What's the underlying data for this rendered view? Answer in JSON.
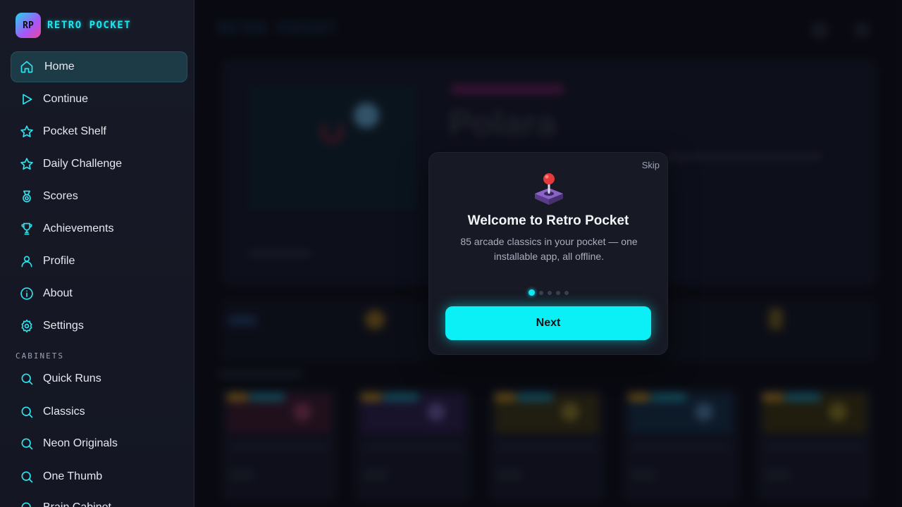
{
  "brand": {
    "logo_text": "RP",
    "name": "RETRO POCKET"
  },
  "nav": [
    {
      "label": "Home",
      "icon": "home-icon",
      "active": true
    },
    {
      "label": "Continue",
      "icon": "play-icon"
    },
    {
      "label": "Pocket Shelf",
      "icon": "star-icon"
    },
    {
      "label": "Daily Challenge",
      "icon": "star-icon"
    },
    {
      "label": "Scores",
      "icon": "medal-icon"
    },
    {
      "label": "Achievements",
      "icon": "trophy-icon"
    },
    {
      "label": "Profile",
      "icon": "user-icon"
    },
    {
      "label": "About",
      "icon": "info-icon"
    },
    {
      "label": "Settings",
      "icon": "gear-icon"
    }
  ],
  "cabinets": {
    "heading": "CABINETS",
    "items": [
      {
        "label": "Quick Runs",
        "icon": "search-icon"
      },
      {
        "label": "Classics",
        "icon": "search-icon"
      },
      {
        "label": "Neon Originals",
        "icon": "search-icon"
      },
      {
        "label": "One Thumb",
        "icon": "search-icon"
      },
      {
        "label": "Brain Cabinet",
        "icon": "search-icon"
      }
    ]
  },
  "background": {
    "header_title": "RETRO POCKET",
    "hero_title": "Polara"
  },
  "modal": {
    "skip_label": "Skip",
    "title": "Welcome to Retro Pocket",
    "body": "85 arcade classics in your pocket — one installable app, all offline.",
    "step_count": 5,
    "current_step": 1,
    "next_label": "Next",
    "accent_color": "#0af0f6"
  }
}
